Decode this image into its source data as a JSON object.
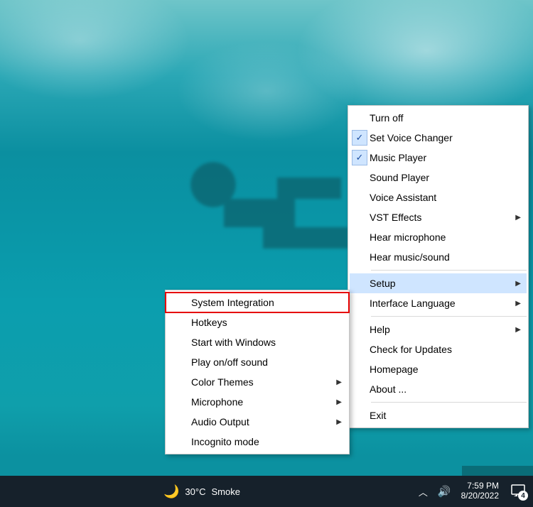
{
  "menu_right": {
    "turn_off": "Turn off",
    "set_voice_changer": "Set Voice Changer",
    "music_player": "Music Player",
    "sound_player": "Sound Player",
    "voice_assistant": "Voice Assistant",
    "vst_effects": "VST Effects",
    "hear_microphone": "Hear microphone",
    "hear_music_sound": "Hear music/sound",
    "setup": "Setup",
    "interface_language": "Interface Language",
    "help": "Help",
    "check_updates": "Check for Updates",
    "homepage": "Homepage",
    "about": "About ...",
    "exit": "Exit"
  },
  "menu_left": {
    "system_integration": "System Integration",
    "hotkeys": "Hotkeys",
    "start_with_windows": "Start with Windows",
    "play_on_off_sound": "Play on/off sound",
    "color_themes": "Color Themes",
    "microphone": "Microphone",
    "audio_output": "Audio Output",
    "incognito_mode": "Incognito mode"
  },
  "taskbar": {
    "temp": "30°C",
    "condition": "Smoke",
    "time": "7:59 PM",
    "date": "8/20/2022",
    "notif_count": "4"
  }
}
